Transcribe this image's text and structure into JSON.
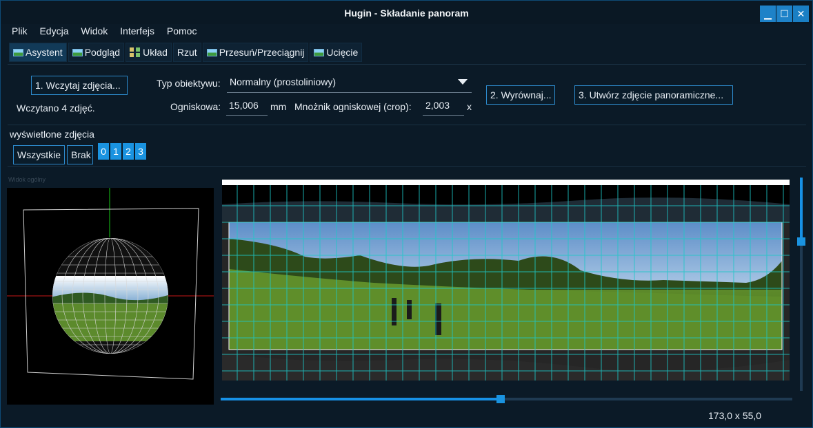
{
  "window": {
    "title": "Hugin - Składanie panoram",
    "minimize": "▁",
    "maximize": "☐",
    "close": "✕"
  },
  "menu": [
    "Plik",
    "Edycja",
    "Widok",
    "Interfejs",
    "Pomoc"
  ],
  "tabs": [
    {
      "label": "Asystent",
      "icon": "assistant-icon",
      "active": true
    },
    {
      "label": "Podgląd",
      "icon": "preview-icon"
    },
    {
      "label": "Układ",
      "icon": "layout-icon"
    },
    {
      "label": "Rzut",
      "icon": ""
    },
    {
      "label": "Przesuń/Przeciągnij",
      "icon": "drag-icon"
    },
    {
      "label": "Ucięcie",
      "icon": "crop-icon"
    }
  ],
  "assistant": {
    "load_button": "1. Wczytaj zdjęcia...",
    "loaded_status": "Wczytano 4 zdjęć.",
    "lens_type_label": "Typ obiektywu:",
    "lens_type_value": "Normalny (prostoliniowy)",
    "focal_label": "Ogniskowa:",
    "focal_value": "15,006",
    "focal_unit": "mm",
    "crop_label": "Mnożnik ogniskowej (crop):",
    "crop_value": "2,003",
    "crop_unit": "x",
    "align_button": "2. Wyrównaj...",
    "create_button": "3. Utwórz zdjęcie panoramiczne..."
  },
  "shown_images": {
    "label": "wyświetlone zdjęcia",
    "all_button": "Wszystkie",
    "none_button": "Brak",
    "images": [
      "0",
      "1",
      "2",
      "3"
    ]
  },
  "overview": {
    "title": "Widok ogólny"
  },
  "preview": {
    "fov_readout": "173,0 x 55,0",
    "horizontal_slider_fraction": 0.49,
    "vertical_slider_fraction": 0.3
  },
  "colors": {
    "accent": "#1a93e0",
    "background": "#0b1a27",
    "grid": "#1ec8c8"
  }
}
